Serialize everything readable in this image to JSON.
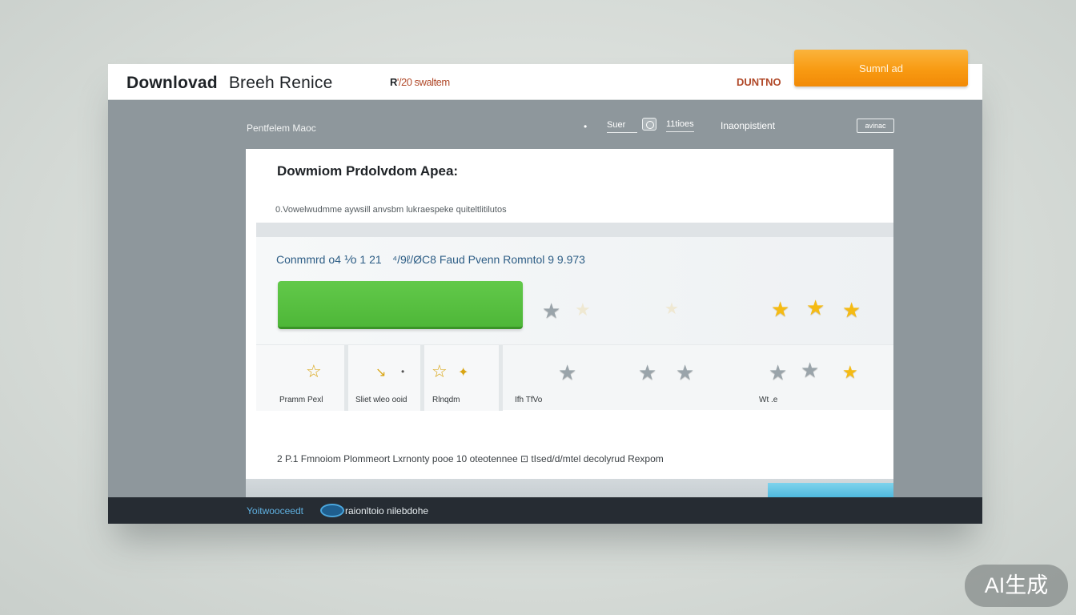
{
  "header": {
    "title": "Downlovad",
    "subtitle": "Breeh Renice",
    "meta_prefix": "R",
    "meta_text": "'/20 swaltem",
    "right_label": "DUNTNO",
    "submit_label": "Sumnl ad"
  },
  "subbar": {
    "left_label": "Pentfelem Maoc",
    "dot": "•",
    "input_value": "Suer",
    "number": "11tioes",
    "text": "Inaonpistient",
    "button_label": "avinac"
  },
  "panel": {
    "title": "Dowmiom Prdolvdom Apea:",
    "description": "0.Vowelwudmme aywsill anvsbm lukraespeke quiteltlitilutos",
    "info_line": "Conmmrd o4 ⅟o 1 21    ⁴/9ℓ/ØC8 Faud Pvenn Romntol 9 9.973",
    "footer_line": "2 P.1 Fmnoiom Plommeort Lxrnonty pooe 10 oteotennee ⊡ tIsed/d/mtel decolyrud Rexpom"
  },
  "rating_row": {
    "cells": [
      {
        "label": "Pramm Pexl"
      },
      {
        "label": "Sliet wleo ooid"
      },
      {
        "label": "Rlnqdm"
      }
    ],
    "label_mid": "Ifh TfVo",
    "label_right": "Wt .e"
  },
  "status": {
    "left": "Yoitwooceedt",
    "right": "raionltoio nilebdohe"
  },
  "watermark": "AI生成",
  "colors": {
    "accent_orange": "#f89a12",
    "accent_green": "#4eb738",
    "link_blue": "#2d5d85",
    "star_gold": "#f5bb13"
  }
}
